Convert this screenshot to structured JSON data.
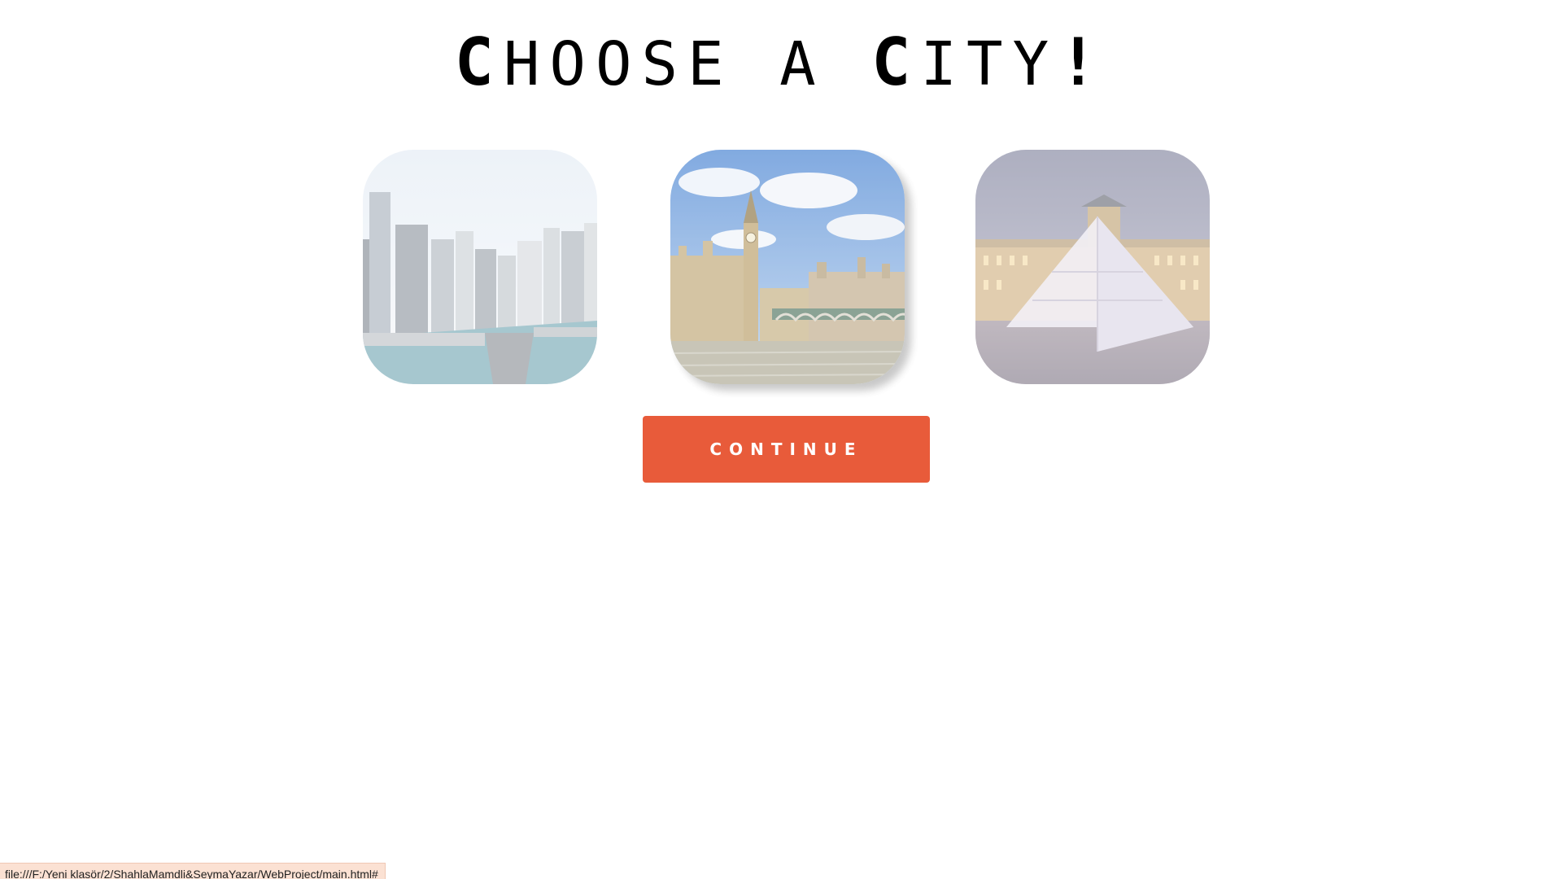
{
  "header": {
    "title_parts": [
      {
        "text": "C",
        "emphasis": true
      },
      {
        "text": "HOOSE A ",
        "emphasis": false
      },
      {
        "text": "C",
        "emphasis": true
      },
      {
        "text": "ITY",
        "emphasis": false
      },
      {
        "text": "!",
        "emphasis": true
      }
    ]
  },
  "cities": [
    {
      "image": "city-skyline-river-photo",
      "state": "dimmed"
    },
    {
      "image": "big-ben-westminster-photo",
      "state": "hovered"
    },
    {
      "image": "louvre-pyramid-photo",
      "state": "dimmed"
    }
  ],
  "actions": {
    "continue_label": "CONTINUE",
    "continue_color": "#e85b3a"
  },
  "status_bar": {
    "url": "file:///F:/Yeni klasör/2/ShahlaMamdli&SeymaYazar/WebProject/main.html#"
  }
}
